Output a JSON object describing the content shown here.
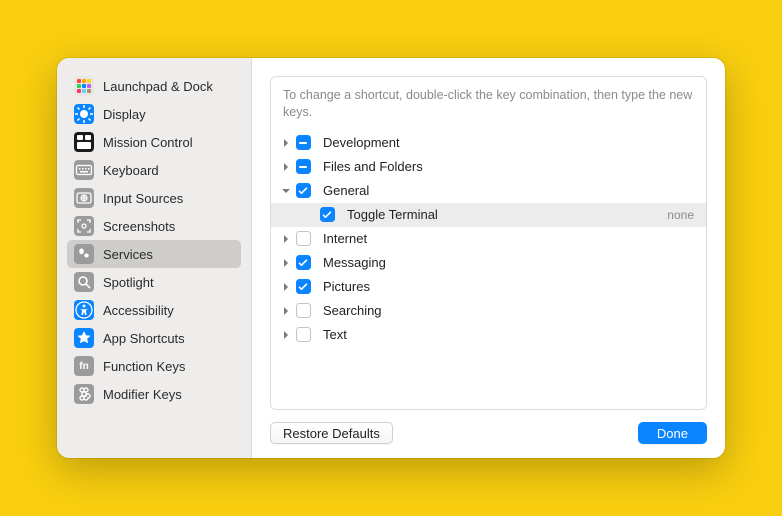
{
  "sidebar": {
    "items": [
      {
        "label": "Launchpad & Dock"
      },
      {
        "label": "Display"
      },
      {
        "label": "Mission Control"
      },
      {
        "label": "Keyboard"
      },
      {
        "label": "Input Sources"
      },
      {
        "label": "Screenshots"
      },
      {
        "label": "Services"
      },
      {
        "label": "Spotlight"
      },
      {
        "label": "Accessibility"
      },
      {
        "label": "App Shortcuts"
      },
      {
        "label": "Function Keys"
      },
      {
        "label": "Modifier Keys"
      }
    ],
    "selected_index": 6
  },
  "main": {
    "hint": "To change a shortcut, double-click the key combination, then type the new keys.",
    "rows": [
      {
        "label": "Development",
        "state": "mixed",
        "expanded": false
      },
      {
        "label": "Files and Folders",
        "state": "mixed",
        "expanded": false
      },
      {
        "label": "General",
        "state": "checked",
        "expanded": true,
        "children": [
          {
            "label": "Toggle Terminal",
            "state": "checked",
            "shortcut": "none"
          }
        ]
      },
      {
        "label": "Internet",
        "state": "unchecked",
        "expanded": false
      },
      {
        "label": "Messaging",
        "state": "checked",
        "expanded": false
      },
      {
        "label": "Pictures",
        "state": "checked",
        "expanded": false
      },
      {
        "label": "Searching",
        "state": "unchecked",
        "expanded": false
      },
      {
        "label": "Text",
        "state": "unchecked",
        "expanded": false
      }
    ],
    "footer": {
      "restore_label": "Restore Defaults",
      "done_label": "Done"
    }
  }
}
